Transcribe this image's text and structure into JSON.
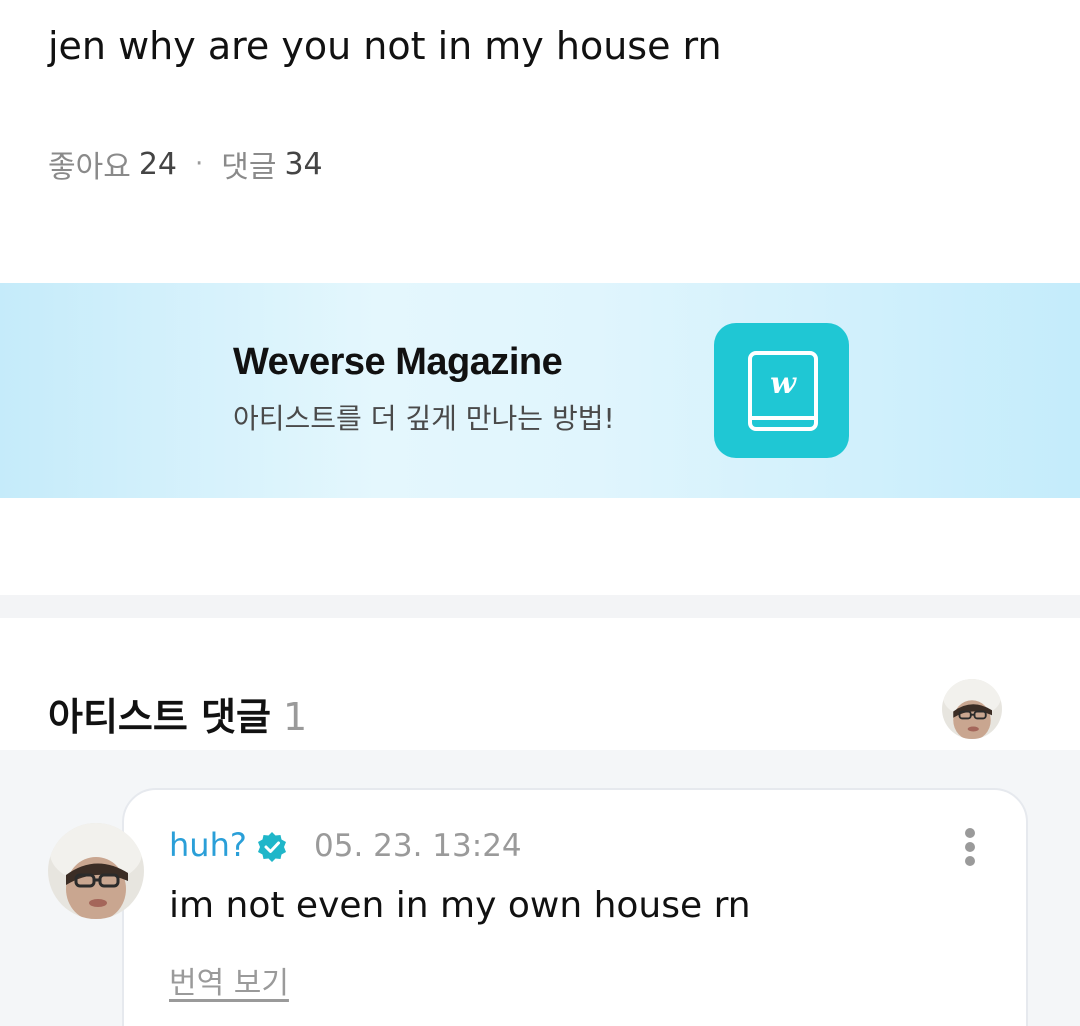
{
  "post": {
    "text": "jen why are you not in my house rn",
    "likes_label": "좋아요",
    "likes_count": "24",
    "separator": "·",
    "comments_label": "댓글",
    "comments_count": "34"
  },
  "banner": {
    "title": "Weverse Magazine",
    "subtitle": "아티스트를 더 깊게 만나는 방법!",
    "logo_icon": "weverse-magazine-book-icon",
    "logo_letter": "w",
    "color_bg": "#d6f1fc",
    "color_logo": "#1fc7d4"
  },
  "artist_comments": {
    "title": "아티스트 댓글",
    "count": "1"
  },
  "comment": {
    "author": "huh?",
    "verified_icon": "verified-badge-icon",
    "timestamp": "05. 23. 13:24",
    "text": "im not even in my own house rn",
    "translate_label": "번역 보기",
    "more_icon": "more-vertical-icon",
    "author_color": "#2a9fd8"
  }
}
